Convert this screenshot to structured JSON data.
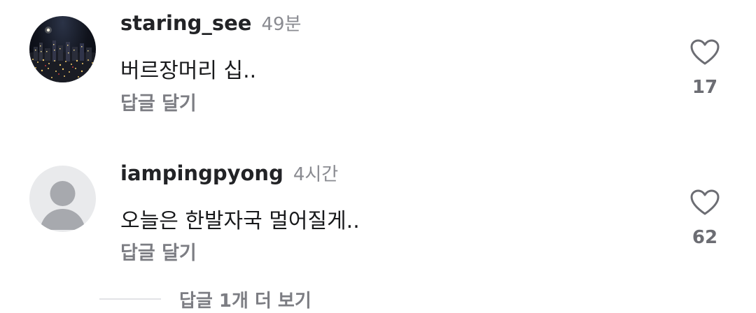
{
  "comments": [
    {
      "username": "staring_see",
      "timestamp": "49분",
      "text": "버르장머리 십..",
      "reply_label": "답글 달기",
      "likes": "17",
      "avatar": "city-night-photo"
    },
    {
      "username": "iampingpyong",
      "timestamp": "4시간",
      "text": "오늘은 한발자국 멀어질게..",
      "reply_label": "답글 달기",
      "likes": "62",
      "avatar": "default-user-icon"
    }
  ],
  "more_replies_label": "답글 1개 더 보기",
  "icons": {
    "like": "heart-outline-icon"
  },
  "colors": {
    "username": "#222326",
    "timestamp": "#8a8b91",
    "text": "#18191b",
    "secondary": "#7c7d83"
  }
}
